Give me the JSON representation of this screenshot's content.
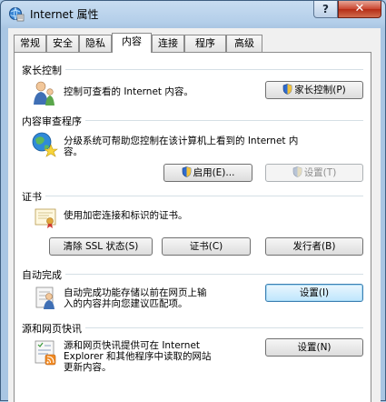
{
  "window": {
    "title": "Internet 属性",
    "help_label": "?",
    "close_label": "✕"
  },
  "tabs": [
    "常规",
    "安全",
    "隐私",
    "内容",
    "连接",
    "程序",
    "高级"
  ],
  "sections": {
    "parental": {
      "title": "家长控制",
      "description": "控制可查看的 Internet 内容。",
      "button": "家长控制(P)"
    },
    "advisor": {
      "title": "内容审查程序",
      "description_line1": "分级系统可帮助您控制在该计算机上看到的 Internet 内",
      "description_line2": "容。",
      "enable_button": "启用(E)...",
      "settings_button": "设置(T)"
    },
    "certificates": {
      "title": "证书",
      "description": "使用加密连接和标识的证书。",
      "clear_ssl_button": "清除 SSL 状态(S)",
      "certificates_button": "证书(C)",
      "publishers_button": "发行者(B)"
    },
    "autocomplete": {
      "title": "自动完成",
      "description_line1": "自动完成功能存储以前在网页上输",
      "description_line2": "入的内容并向您建议匹配项。",
      "button": "设置(I)"
    },
    "feeds": {
      "title": "源和网页快讯",
      "description_line1": "源和网页快讯提供可在 Internet",
      "description_line2": "Explorer 和其他程序中读取的网站",
      "description_line3": "更新内容。",
      "button": "设置(N)"
    }
  },
  "active_tab_index": 3
}
